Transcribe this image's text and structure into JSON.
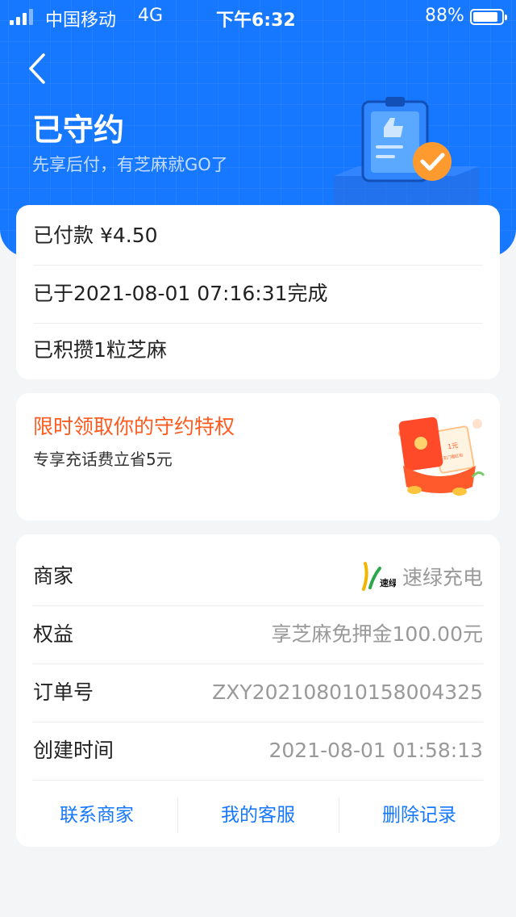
{
  "status_bar": {
    "carrier": "中国移动",
    "network": "4G",
    "time": "下午6:32",
    "battery_pct": "88%",
    "battery_level": 0.88
  },
  "header": {
    "back_icon": "chevron-left-icon",
    "title": "已守约",
    "subtitle": "先享后付，有芝麻就GO了"
  },
  "summary": {
    "rows": [
      "已付款 ¥4.50",
      "已于2021-08-01 07:16:31完成",
      "已积攒1粒芝麻"
    ]
  },
  "promo": {
    "title": "限时领取你的守约特权",
    "subtitle": "专享充话费立省5元",
    "image_icon": "red-envelope-coupon-icon",
    "coupon_text": "1元",
    "coupon_subtext": "无门槛红包"
  },
  "details": {
    "merchant": {
      "label": "商家",
      "value": "速绿充电",
      "logo_text": "速绿"
    },
    "benefit": {
      "label": "权益",
      "value": "享芝麻免押金100.00元"
    },
    "order_no": {
      "label": "订单号",
      "value": "ZXY202108010158004325"
    },
    "created": {
      "label": "创建时间",
      "value": "2021-08-01 01:58:13"
    }
  },
  "actions": {
    "contact": "联系商家",
    "service": "我的客服",
    "delete": "删除记录"
  },
  "colors": {
    "primary": "#1677ff",
    "promo": "#ff5a1f",
    "check_badge": "#ff9a2e"
  }
}
